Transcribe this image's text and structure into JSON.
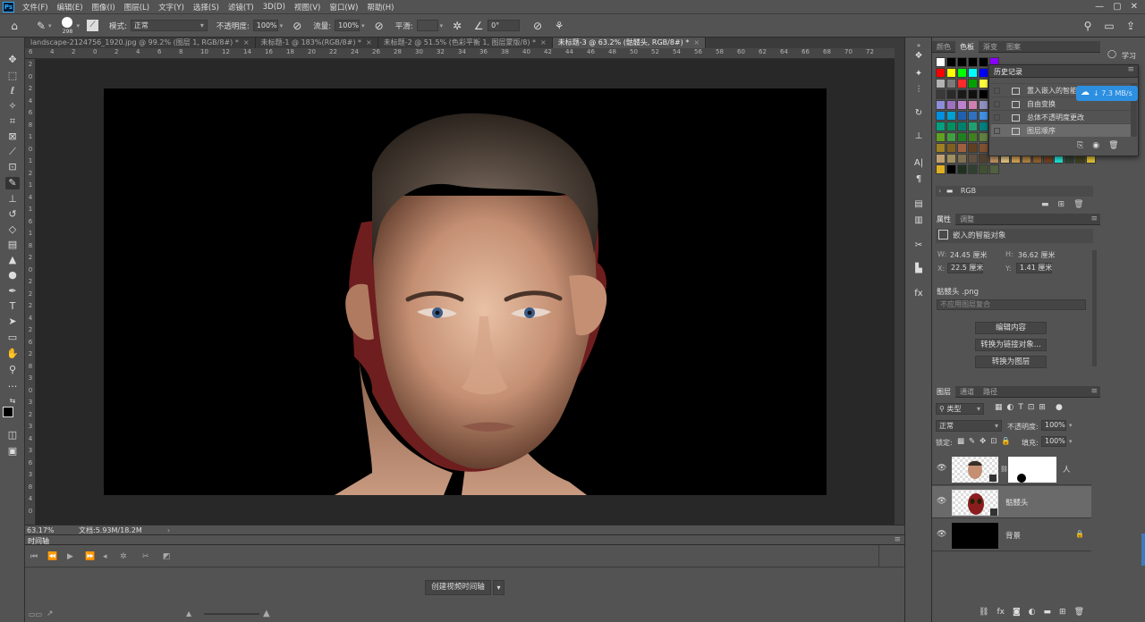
{
  "app": {
    "logo": "Ps"
  },
  "menu": [
    "文件(F)",
    "编辑(E)",
    "图像(I)",
    "图层(L)",
    "文字(Y)",
    "选择(S)",
    "滤镜(T)",
    "3D(D)",
    "视图(V)",
    "窗口(W)",
    "帮助(H)"
  ],
  "options": {
    "brush_size": "298",
    "mode_label": "模式:",
    "mode_value": "正常",
    "opacity_label": "不透明度:",
    "opacity_value": "100%",
    "flow_label": "流量:",
    "flow_value": "100%",
    "smoothing_label": "平滑:",
    "angle_value": "0°"
  },
  "tabs": [
    {
      "label": "landscape-2124756_1920.jpg @ 99.2% (图层 1, RGB/8#) *"
    },
    {
      "label": "未标题-1 @ 183%(RGB/8#) *"
    },
    {
      "label": "未标题-2 @ 51.5% (色彩平衡 1, 图层蒙版/8) *"
    },
    {
      "label": "未标题-3 @ 63.2% (骷髅头, RGB/8#) *",
      "active": true
    }
  ],
  "ruler_top": [
    "6",
    "4",
    "2",
    "0",
    "2",
    "4",
    "6",
    "8",
    "10",
    "12",
    "14",
    "16",
    "18",
    "20",
    "22",
    "24",
    "26",
    "28",
    "30",
    "32",
    "34",
    "36",
    "38",
    "40",
    "42",
    "44",
    "46",
    "48",
    "50",
    "52",
    "54",
    "56",
    "58",
    "60",
    "62",
    "64",
    "66",
    "68",
    "70",
    "72"
  ],
  "ruler_left": [
    "2",
    "0",
    "2",
    "4",
    "6",
    "8",
    "1",
    "0",
    "1",
    "2",
    "1",
    "4",
    "1",
    "6",
    "1",
    "8",
    "2",
    "0",
    "2",
    "2",
    "2",
    "4",
    "2",
    "6",
    "2",
    "8",
    "3",
    "0",
    "3",
    "2",
    "3",
    "4",
    "3",
    "6",
    "3",
    "8",
    "4",
    "0"
  ],
  "status": {
    "zoom": "63.17%",
    "doc": "文档:5.93M/18.2M"
  },
  "timeline": {
    "title": "时间轴",
    "create_button": "创建视频时间轴"
  },
  "swatches_panel": {
    "tabs": [
      "颜色",
      "色板",
      "渐变",
      "图案"
    ],
    "active_tab": "色板",
    "group_name": "RGB",
    "colors": [
      [
        "#ffffff",
        "#000000",
        "#000000",
        "#000000",
        "#000000",
        "#8b00ff"
      ],
      [
        "#ff0000",
        "#ffff00",
        "#00ff00",
        "#00ffff",
        "#0000ff",
        "#ff00ff"
      ],
      [
        "#b3b3b3",
        "#7a7a7a",
        "#ff2a2a",
        "#00a000",
        "#ffff40",
        "#2040ff"
      ],
      [
        "#3a3a3a",
        "#2a2a2a",
        "#1a1a1a",
        "#101010",
        "#000000",
        "#e89a6a"
      ],
      [
        "#8d8dd8",
        "#a070c0",
        "#c080d0",
        "#d080b0",
        "#9090c0",
        "#c0a0e0"
      ],
      [
        "#0090e0",
        "#00a0d0",
        "#2060b0",
        "#3070c0",
        "#4090e0",
        "#6060b0"
      ],
      [
        "#00a080",
        "#009060",
        "#00806a",
        "#20a070",
        "#008080",
        "#50a090"
      ],
      [
        "#60a020",
        "#40a040",
        "#208020",
        "#408020",
        "#608040",
        "#80a020"
      ],
      [
        "#a08020",
        "#806020",
        "#a06040",
        "#604020",
        "#805030",
        "#a07040"
      ],
      [
        "#c0a070",
        "#a09060",
        "#807050",
        "#605040",
        "#504030",
        "#c09060",
        "#e0c080",
        "#d0a050",
        "#b08040",
        "#906030",
        "#704020",
        "#20e0d0",
        "#304030",
        "#404020",
        "#e0c030"
      ],
      [
        "#e0b020",
        "#000000",
        "#203020",
        "#304030",
        "#405030",
        "#506040"
      ]
    ]
  },
  "history_panel": {
    "title": "历史记录",
    "items": [
      "置入嵌入的智能对象",
      "自由变换",
      "总体不透明度更改",
      "图层顺序"
    ]
  },
  "netspeed": {
    "value": "↓ 7.3 MB/s"
  },
  "properties_panel": {
    "tabs": [
      "属性",
      "调整"
    ],
    "object_type": "嵌入的智能对象",
    "w_label": "W:",
    "w_value": "24.45 厘米",
    "h_label": "H:",
    "h_value": "36.62 厘米",
    "x_label": "X:",
    "x_value": "22.5 厘米",
    "y_label": "Y:",
    "y_value": "1.41 厘米",
    "filename": "骷髅头 .png",
    "comp_placeholder": "不应用图层复合",
    "buttons": [
      "编辑内容",
      "转换为链接对象...",
      "转换为图层"
    ]
  },
  "layers_panel": {
    "tabs": [
      "图层",
      "通道",
      "路径"
    ],
    "filter_kind": "类型",
    "blend_mode": "正常",
    "opacity_label": "不透明度:",
    "opacity_value": "100%",
    "lock_label": "锁定:",
    "fill_label": "填充:",
    "fill_value": "100%",
    "layers": [
      {
        "name": "人"
      },
      {
        "name": "骷髅头"
      },
      {
        "name": "背景"
      }
    ]
  },
  "right_strip": {
    "learn": "学习"
  }
}
